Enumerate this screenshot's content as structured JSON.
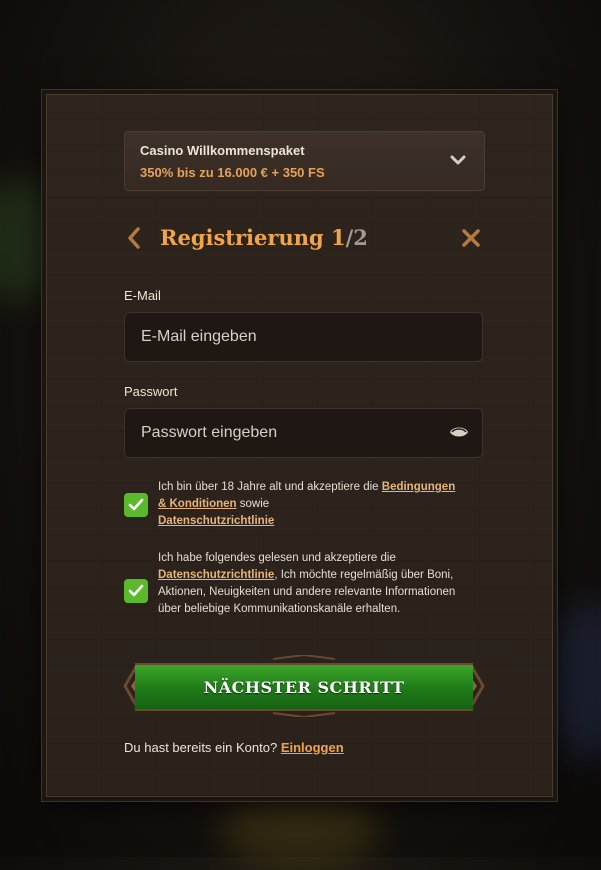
{
  "promo": {
    "title": "Casino Willkommenspaket",
    "subtitle": "350% bis zu 16.000 € + 350 FS"
  },
  "registration": {
    "title": "Registrierung",
    "step_current": "1",
    "step_total": "/2"
  },
  "email": {
    "label": "E-Mail",
    "placeholder": "E-Mail eingeben",
    "value": ""
  },
  "password": {
    "label": "Passwort",
    "placeholder": "Passwort eingeben",
    "value": ""
  },
  "consent1": {
    "checked": true,
    "text_before": "Ich bin über 18 Jahre alt und akzeptiere die ",
    "link1": "Bedingungen & Konditionen",
    "text_middle": " sowie ",
    "link2": "Datenschutzrichtlinie"
  },
  "consent2": {
    "checked": true,
    "text_before": "Ich habe folgendes gelesen und akzeptiere die ",
    "link1": "Datenschutzrichtlinie",
    "text_after": ", Ich möchte regelmäßig über Boni, Aktionen, Neuigkeiten und andere relevante Informationen über beliebige Kommunikationskanäle erhalten."
  },
  "cta": {
    "label": "NÄCHSTER SCHRITT"
  },
  "login": {
    "prompt": "Du hast bereits ein Konto? ",
    "link": "Einloggen"
  },
  "colors": {
    "accent": "#f0a54a",
    "checkbox": "#5bba2c",
    "cta_green": "#2a8f20"
  },
  "icons": [
    "chevron-down-icon",
    "chevron-left-icon",
    "close-icon",
    "eye-icon",
    "checkmark-icon"
  ]
}
